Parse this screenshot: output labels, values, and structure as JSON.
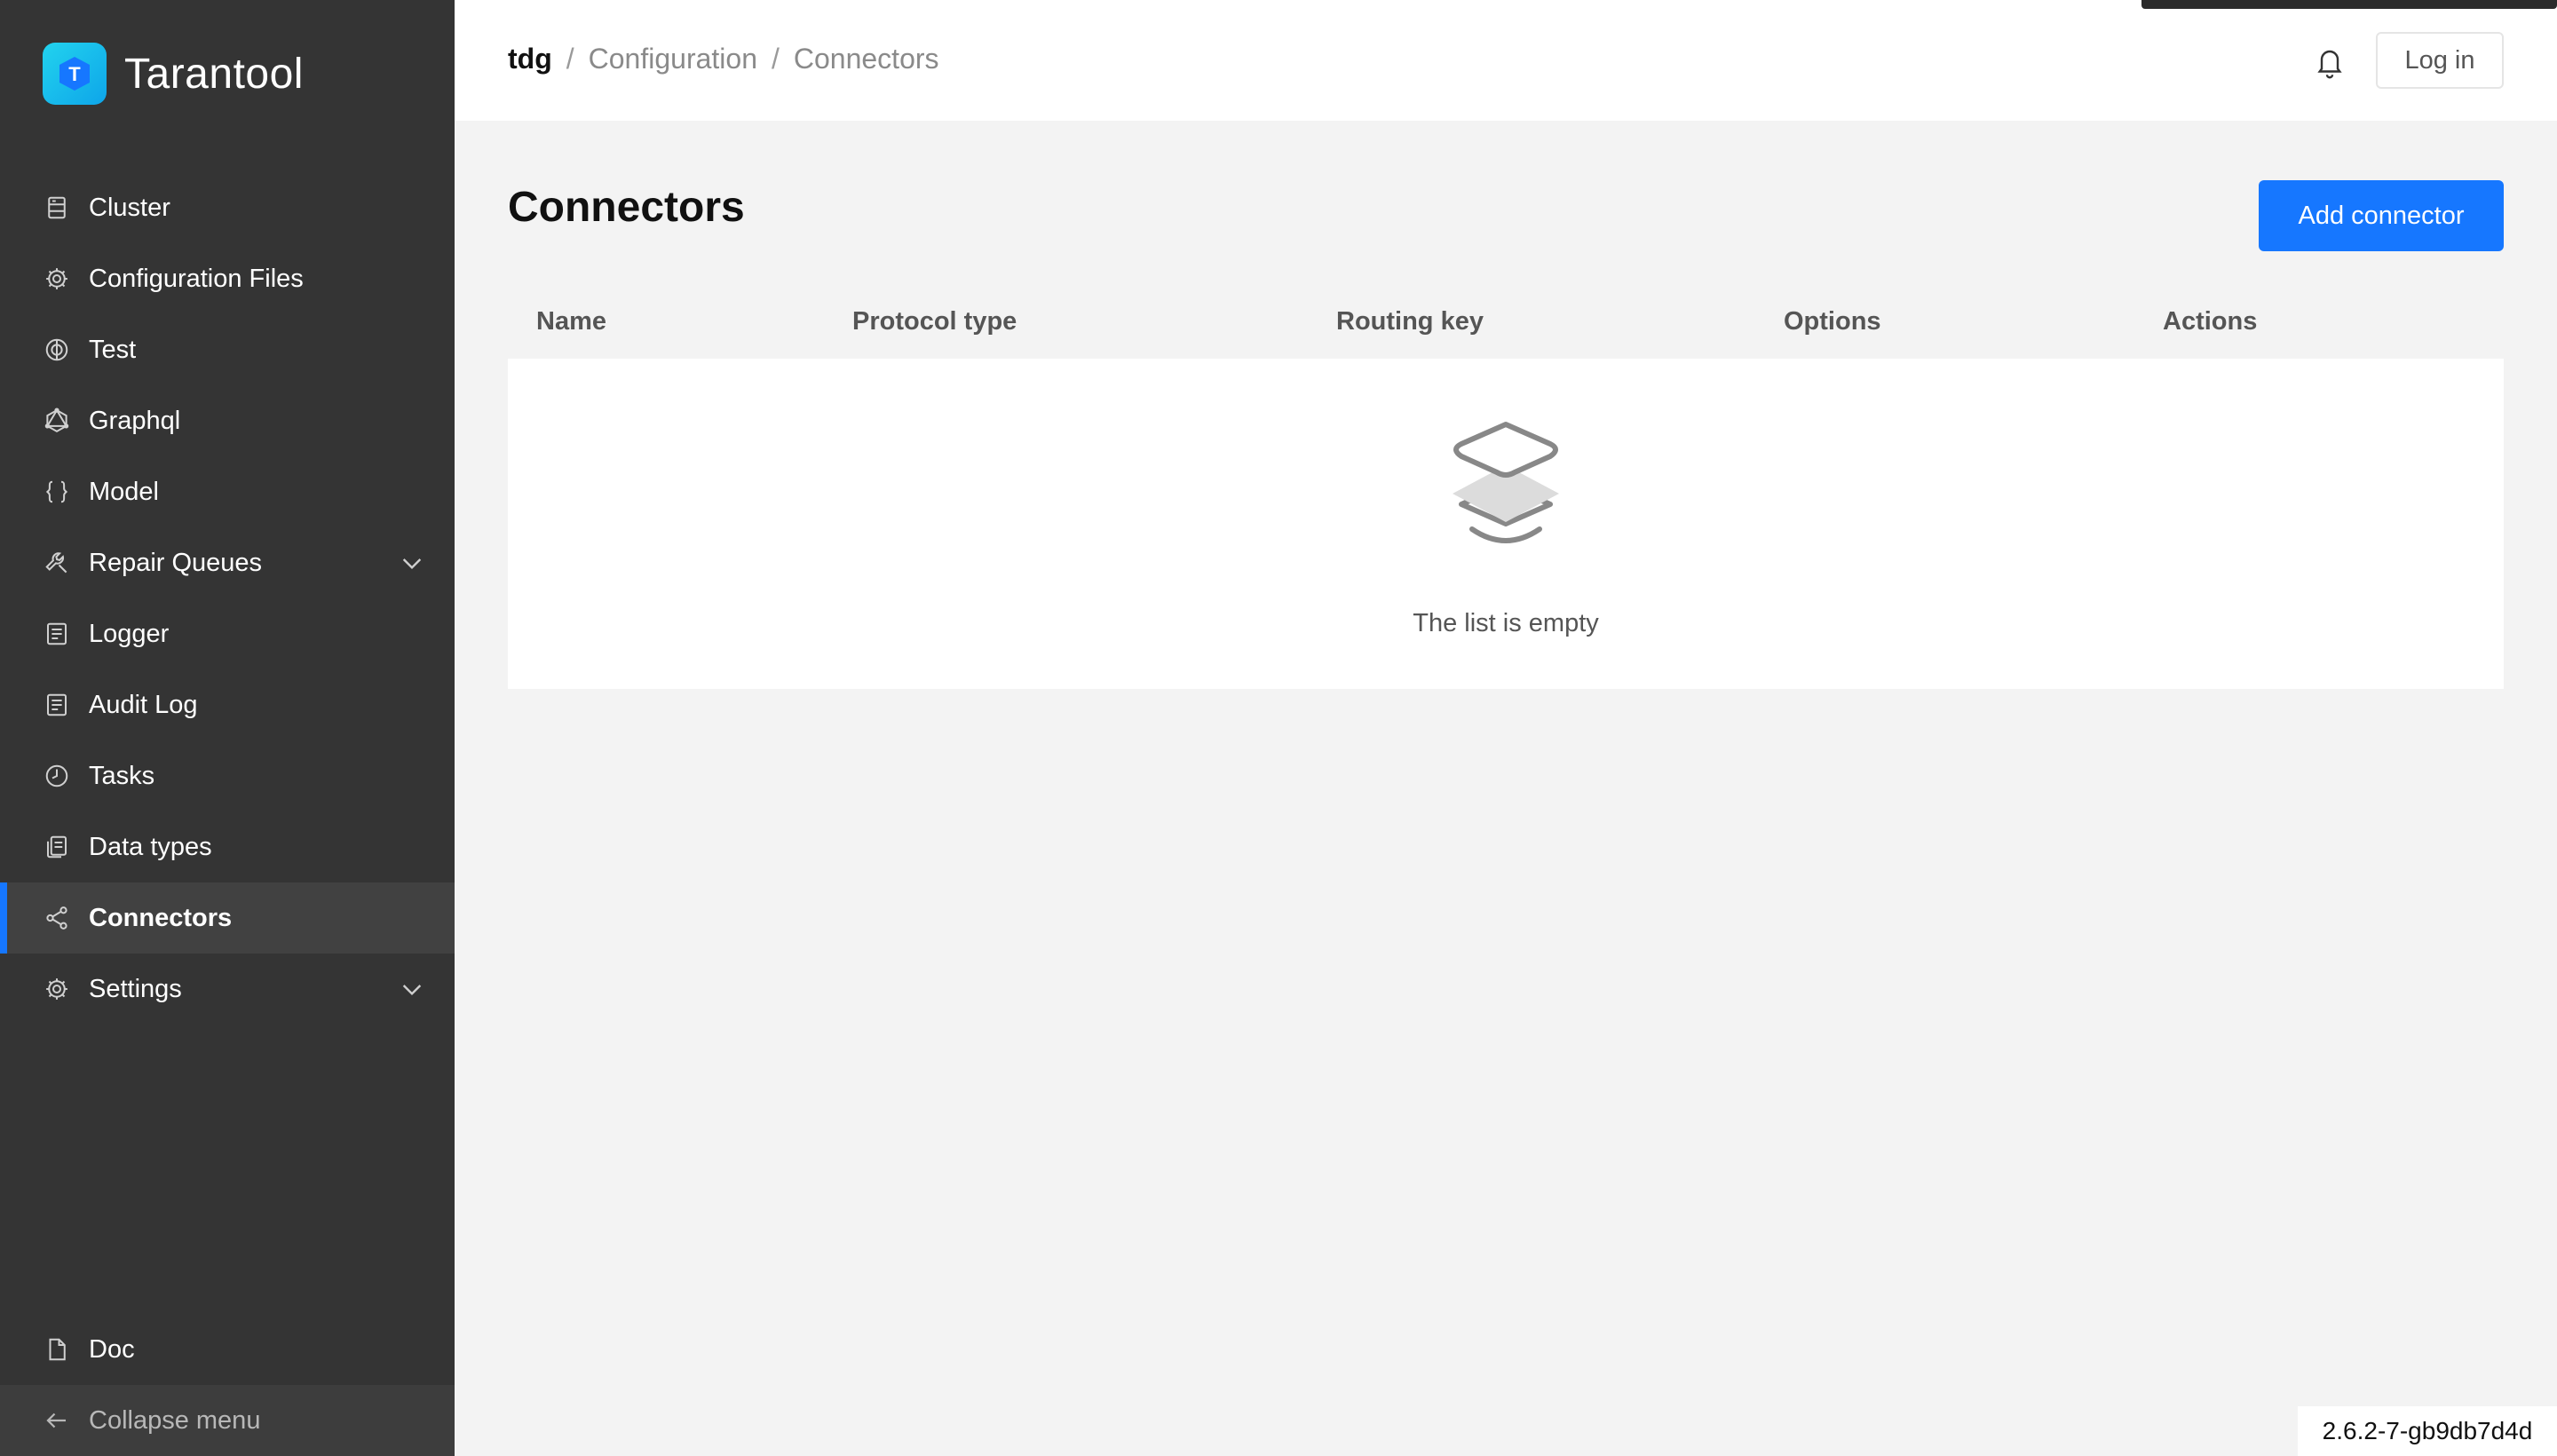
{
  "app": {
    "name": "Tarantool",
    "logo_letter": "T",
    "brand_color": "#1677ff"
  },
  "breadcrumb": {
    "root": "tdg",
    "items": [
      "Configuration",
      "Connectors"
    ],
    "separator": "/"
  },
  "header": {
    "login_label": "Log in"
  },
  "sidebar": {
    "items": [
      {
        "label": "Cluster",
        "icon": "server-icon"
      },
      {
        "label": "Configuration Files",
        "icon": "gear-icon"
      },
      {
        "label": "Test",
        "icon": "target-icon"
      },
      {
        "label": "Graphql",
        "icon": "graphql-icon"
      },
      {
        "label": "Model",
        "icon": "braces-icon"
      },
      {
        "label": "Repair Queues",
        "icon": "wrench-icon",
        "expandable": true
      },
      {
        "label": "Logger",
        "icon": "document-icon"
      },
      {
        "label": "Audit Log",
        "icon": "document-icon"
      },
      {
        "label": "Tasks",
        "icon": "clock-icon"
      },
      {
        "label": "Data types",
        "icon": "files-icon"
      },
      {
        "label": "Connectors",
        "icon": "share-icon",
        "active": true
      },
      {
        "label": "Settings",
        "icon": "gear-icon",
        "expandable": true
      }
    ],
    "bottom": [
      {
        "label": "Doc",
        "icon": "file-icon"
      },
      {
        "label": "Collapse menu",
        "icon": "arrow-left-icon"
      }
    ]
  },
  "main": {
    "title": "Connectors",
    "add_button_label": "Add connector",
    "table": {
      "columns": [
        "Name",
        "Protocol type",
        "Routing key",
        "Options",
        "Actions"
      ],
      "rows": [],
      "empty_text": "The list is empty"
    }
  },
  "footer": {
    "version": "2.6.2-7-gb9db7d4d"
  }
}
